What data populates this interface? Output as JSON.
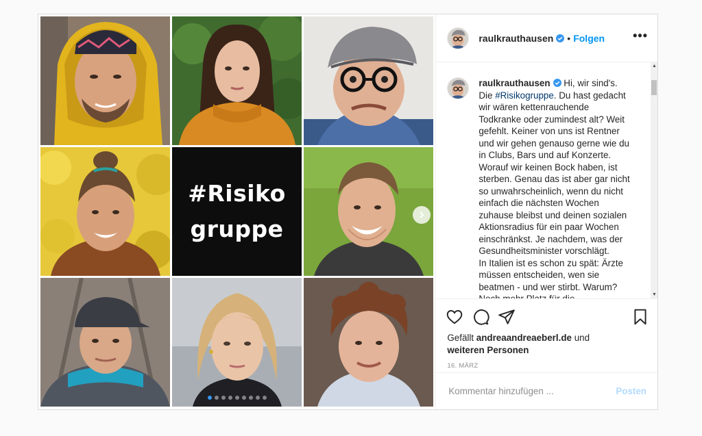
{
  "post": {
    "username": "raulkrauthausen",
    "header_separator": "•",
    "follow_label": "Folgen",
    "more_label": "•••",
    "colors": {
      "accent": "#0095f6",
      "hashtag": "#00376b",
      "muted": "#8e8e8e",
      "post_disabled": "#b3dbff"
    }
  },
  "media": {
    "tile_text_line1": "#Risiko",
    "tile_text_line2": "gruppe",
    "carousel_dots": 9,
    "carousel_active_index": 0,
    "next_icon": "chevron-right-icon"
  },
  "caption": {
    "username": "raulkrauthausen",
    "text_before_hashtag": " Hi, wir sind's. Die ",
    "hashtag": "#Risikogruppe",
    "text_after_hashtag": ". Du hast gedacht wir wären kettenrauchende Todkranke oder zumindest alt? Weit gefehlt. Keiner von uns ist Rentner und wir gehen genauso gerne wie du in Clubs, Bars und auf Konzerte. Worauf wir keinen Bock haben, ist sterben. Genau das ist aber gar nicht so unwahrscheinlich, wenn du nicht einfach die nächsten Wochen zuhause bleibst und deinen sozialen Aktionsradius für ein paar Wochen einschränkst. Je nachdem, was der Gesundheitsminister vorschlägt.\nIn Italien ist es schon zu spät: Ärzte müssen entscheiden, wen sie beatmen - und wer stirbt. Warum?\nNoch mehr Platz für die..."
  },
  "actions": {
    "like_icon": "heart-icon",
    "comment_icon": "comment-icon",
    "share_icon": "paper-plane-icon",
    "save_icon": "bookmark-icon"
  },
  "likes": {
    "prefix": "Gefällt ",
    "user": "andreaandreaeberl.de",
    "middle": " und",
    "others": "weiteren Personen"
  },
  "date": "16. März",
  "comment": {
    "placeholder": "Kommentar hinzufügen ...",
    "post_label": "Posten"
  }
}
